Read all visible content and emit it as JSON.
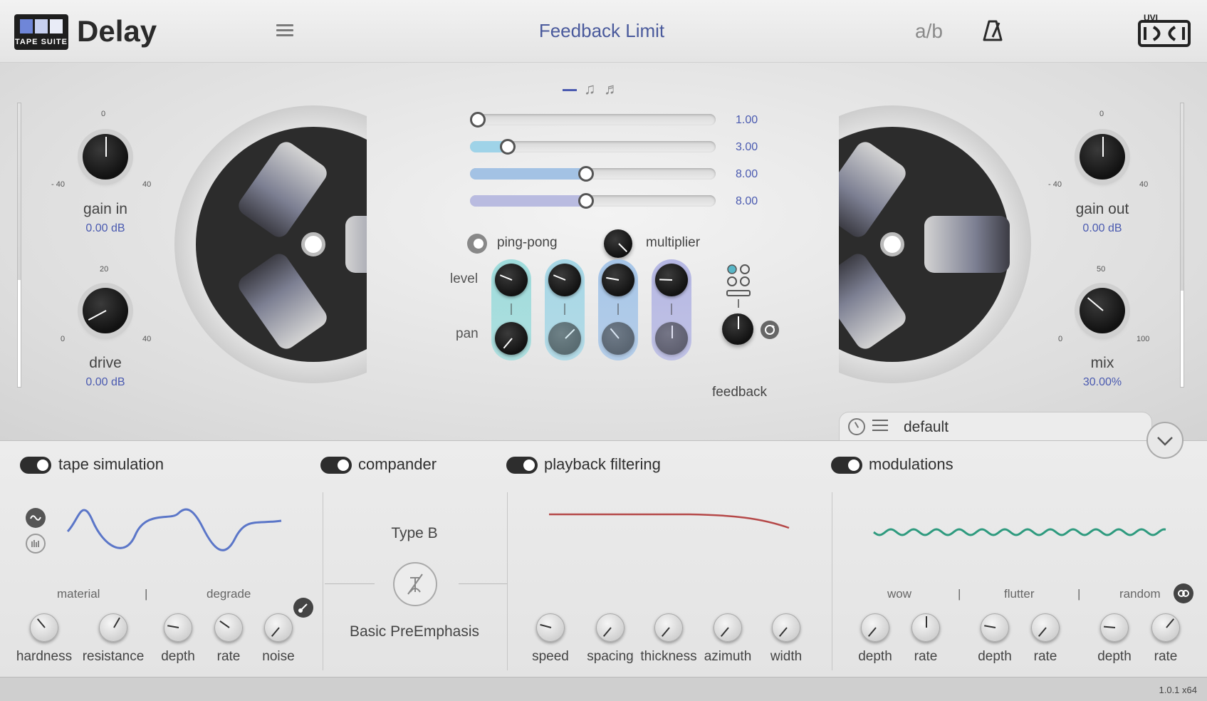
{
  "header": {
    "logo_text": "TAPE SUITE",
    "app_title": "Delay",
    "preset_title": "Feedback Limit",
    "ab_label": "a/b"
  },
  "left_panel": {
    "gain_in": {
      "label": "gain in",
      "value": "0.00 dB",
      "tick_top": "0",
      "tick_left": "- 40",
      "tick_right": "40"
    },
    "drive": {
      "label": "drive",
      "value": "0.00 dB",
      "tick_top": "20",
      "tick_left": "0",
      "tick_right": "40"
    }
  },
  "right_panel": {
    "gain_out": {
      "label": "gain out",
      "value": "0.00 dB",
      "tick_top": "0",
      "tick_left": "- 40",
      "tick_right": "40"
    },
    "mix": {
      "label": "mix",
      "value": "30.00%",
      "tick_top": "50",
      "tick_left": "0",
      "tick_right": "100"
    }
  },
  "sliders": [
    {
      "value_label": "1.00",
      "fraction": 0.0,
      "color": "#e2e2e2"
    },
    {
      "value_label": "3.00",
      "fraction": 0.13,
      "color": "#9fd3e8"
    },
    {
      "value_label": "8.00",
      "fraction": 0.47,
      "color": "#a3c2e4"
    },
    {
      "value_label": "8.00",
      "fraction": 0.47,
      "color": "#b9bbe0"
    }
  ],
  "center": {
    "ping_pong_label": "ping-pong",
    "multiplier_label": "multiplier",
    "level_label": "level",
    "pan_label": "pan",
    "feedback_label": "feedback",
    "tap_colors": [
      "#9fdcdc",
      "#a6d7e6",
      "#a7c6e8",
      "#b6b8e4"
    ]
  },
  "preset_bar": {
    "name": "default"
  },
  "sections": {
    "tape_simulation": {
      "title": "tape simulation",
      "group_material": "material",
      "group_degrade": "degrade",
      "knobs": [
        "hardness",
        "resistance",
        "depth",
        "rate",
        "noise"
      ]
    },
    "compander": {
      "title": "compander",
      "type_label": "Type B",
      "mode_label": "Basic PreEmphasis"
    },
    "playback_filtering": {
      "title": "playback filtering",
      "knobs": [
        "speed",
        "spacing",
        "thickness",
        "azimuth",
        "width"
      ]
    },
    "modulations": {
      "title": "modulations",
      "group_wow": "wow",
      "group_flutter": "flutter",
      "group_random": "random",
      "knobs": [
        "depth",
        "rate",
        "depth",
        "rate",
        "depth",
        "rate"
      ]
    }
  },
  "footer": {
    "version": "1.0.1 x64"
  }
}
